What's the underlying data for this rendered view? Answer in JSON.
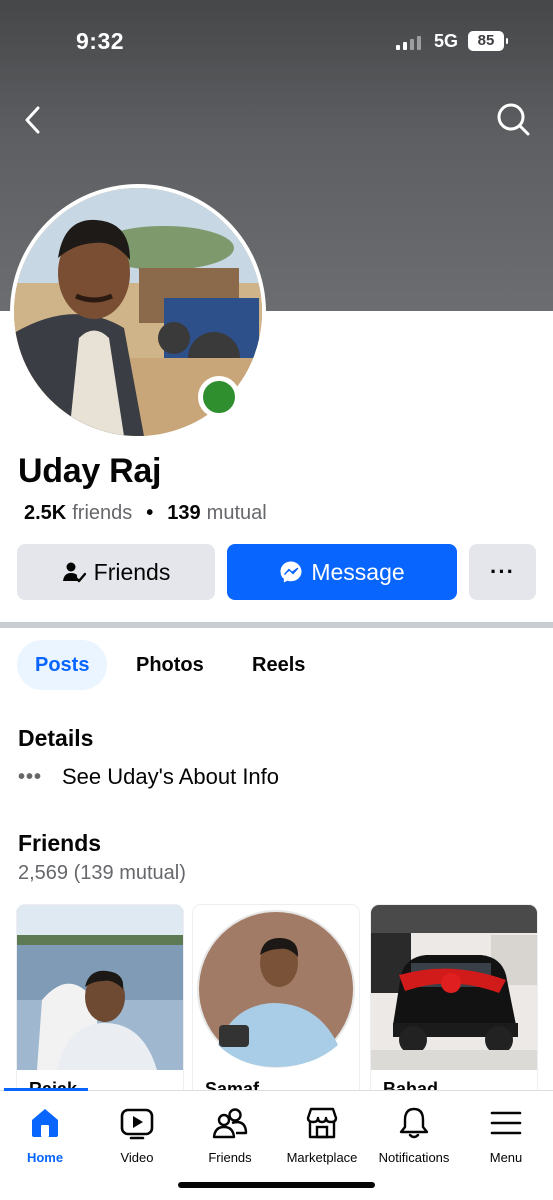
{
  "status_bar": {
    "time": "9:32",
    "network": "5G",
    "battery": "85"
  },
  "header": {
    "back_icon": "chevron-left-icon",
    "search_icon": "search-icon"
  },
  "profile": {
    "name": "Uday Raj",
    "friends_count": "2.5K",
    "friends_word": "friends",
    "separator": "•",
    "mutual_count": "139",
    "mutual_word": "mutual",
    "online_color": "#2f8f2f"
  },
  "actions": {
    "friends_label": "Friends",
    "message_label": "Message",
    "more_label": "···",
    "message_color": "#0866ff"
  },
  "tabs": [
    {
      "label": "Posts",
      "active": true
    },
    {
      "label": "Photos",
      "active": false
    },
    {
      "label": "Reels",
      "active": false
    }
  ],
  "details": {
    "title": "Details",
    "about_dots": "•••",
    "about_label": "See Uday's About Info"
  },
  "friends_section": {
    "title": "Friends",
    "count_label": "2,569 (139 mutual)",
    "cards": [
      {
        "name": "Rajak"
      },
      {
        "name": "Samaf"
      },
      {
        "name": "Bahad"
      }
    ]
  },
  "bottom_nav": [
    {
      "label": "Home",
      "icon": "home-icon",
      "active": true
    },
    {
      "label": "Video",
      "icon": "video-icon",
      "active": false
    },
    {
      "label": "Friends",
      "icon": "friends-icon",
      "active": false
    },
    {
      "label": "Marketplace",
      "icon": "marketplace-icon",
      "active": false
    },
    {
      "label": "Notifications",
      "icon": "bell-icon",
      "active": false
    },
    {
      "label": "Menu",
      "icon": "menu-icon",
      "active": false
    }
  ]
}
